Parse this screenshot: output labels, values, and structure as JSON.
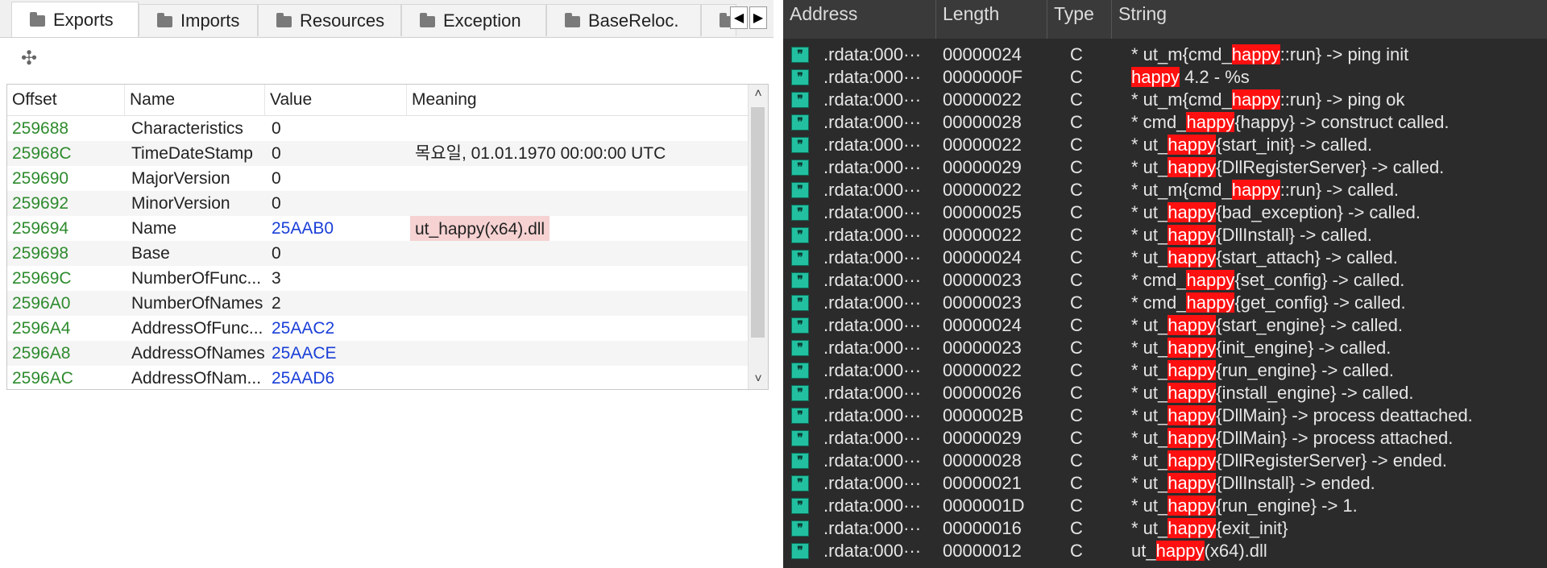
{
  "left": {
    "tabs": [
      {
        "label": "Exports",
        "icon": "folder-icon",
        "active": true
      },
      {
        "label": "Imports",
        "icon": "folder-icon",
        "active": false
      },
      {
        "label": "Resources",
        "icon": "folder-icon",
        "active": false
      },
      {
        "label": "Exception",
        "icon": "folder-icon",
        "active": false
      },
      {
        "label": "BaseReloc.",
        "icon": "folder-icon",
        "active": false
      }
    ],
    "tab_nav": {
      "prev": "◀",
      "next": "▶"
    },
    "move_icon": "✣",
    "columns": [
      "Offset",
      "Name",
      "Value",
      "Meaning"
    ],
    "rows": [
      {
        "offset": "259688",
        "name": "Characteristics",
        "value": "0",
        "meaning": "",
        "value_link": false,
        "meaning_highlight": false
      },
      {
        "offset": "25968C",
        "name": "TimeDateStamp",
        "value": "0",
        "meaning": "목요일, 01.01.1970 00:00:00 UTC",
        "value_link": false,
        "meaning_highlight": false
      },
      {
        "offset": "259690",
        "name": "MajorVersion",
        "value": "0",
        "meaning": "",
        "value_link": false,
        "meaning_highlight": false
      },
      {
        "offset": "259692",
        "name": "MinorVersion",
        "value": "0",
        "meaning": "",
        "value_link": false,
        "meaning_highlight": false
      },
      {
        "offset": "259694",
        "name": "Name",
        "value": "25AAB0",
        "meaning": "ut_happy(x64).dll",
        "value_link": true,
        "meaning_highlight": true
      },
      {
        "offset": "259698",
        "name": "Base",
        "value": "0",
        "meaning": "",
        "value_link": false,
        "meaning_highlight": false
      },
      {
        "offset": "25969C",
        "name": "NumberOfFunc...",
        "value": "3",
        "meaning": "",
        "value_link": false,
        "meaning_highlight": false
      },
      {
        "offset": "2596A0",
        "name": "NumberOfNames",
        "value": "2",
        "meaning": "",
        "value_link": false,
        "meaning_highlight": false
      },
      {
        "offset": "2596A4",
        "name": "AddressOfFunc...",
        "value": "25AAC2",
        "meaning": "",
        "value_link": true,
        "meaning_highlight": false
      },
      {
        "offset": "2596A8",
        "name": "AddressOfNames",
        "value": "25AACE",
        "meaning": "",
        "value_link": true,
        "meaning_highlight": false
      },
      {
        "offset": "2596AC",
        "name": "AddressOfNam...",
        "value": "25AAD6",
        "meaning": "",
        "value_link": true,
        "meaning_highlight": false
      }
    ],
    "scroll_up": "˄",
    "scroll_down": "˅"
  },
  "right": {
    "columns": [
      "Address",
      "Length",
      "Type",
      "String"
    ],
    "string_icon": "string-icon",
    "rows": [
      {
        "address": ".rdata:000···",
        "length": "00000024",
        "type": "C",
        "parts": [
          [
            "* ut_m{cmd_",
            false
          ],
          [
            "happy",
            true
          ],
          [
            "::run} -> ping init",
            false
          ]
        ]
      },
      {
        "address": ".rdata:000···",
        "length": "0000000F",
        "type": "C",
        "parts": [
          [
            "happy",
            true
          ],
          [
            " 4.2 - %s",
            false
          ]
        ]
      },
      {
        "address": ".rdata:000···",
        "length": "00000022",
        "type": "C",
        "parts": [
          [
            "* ut_m{cmd_",
            false
          ],
          [
            "happy",
            true
          ],
          [
            "::run} -> ping ok",
            false
          ]
        ]
      },
      {
        "address": ".rdata:000···",
        "length": "00000028",
        "type": "C",
        "parts": [
          [
            "* cmd_",
            false
          ],
          [
            "happy",
            true
          ],
          [
            "{happy} -> construct called.",
            false
          ]
        ]
      },
      {
        "address": ".rdata:000···",
        "length": "00000022",
        "type": "C",
        "parts": [
          [
            "* ut_",
            false
          ],
          [
            "happy",
            true
          ],
          [
            "{start_init} -> called.",
            false
          ]
        ]
      },
      {
        "address": ".rdata:000···",
        "length": "00000029",
        "type": "C",
        "parts": [
          [
            "* ut_",
            false
          ],
          [
            "happy",
            true
          ],
          [
            "{DllRegisterServer} -> called.",
            false
          ]
        ]
      },
      {
        "address": ".rdata:000···",
        "length": "00000022",
        "type": "C",
        "parts": [
          [
            "* ut_m{cmd_",
            false
          ],
          [
            "happy",
            true
          ],
          [
            "::run} -> called.",
            false
          ]
        ]
      },
      {
        "address": ".rdata:000···",
        "length": "00000025",
        "type": "C",
        "parts": [
          [
            "* ut_",
            false
          ],
          [
            "happy",
            true
          ],
          [
            "{bad_exception} -> called.",
            false
          ]
        ]
      },
      {
        "address": ".rdata:000···",
        "length": "00000022",
        "type": "C",
        "parts": [
          [
            "* ut_",
            false
          ],
          [
            "happy",
            true
          ],
          [
            "{DllInstall} -> called.",
            false
          ]
        ]
      },
      {
        "address": ".rdata:000···",
        "length": "00000024",
        "type": "C",
        "parts": [
          [
            "* ut_",
            false
          ],
          [
            "happy",
            true
          ],
          [
            "{start_attach} -> called.",
            false
          ]
        ]
      },
      {
        "address": ".rdata:000···",
        "length": "00000023",
        "type": "C",
        "parts": [
          [
            "* cmd_",
            false
          ],
          [
            "happy",
            true
          ],
          [
            "{set_config} -> called.",
            false
          ]
        ]
      },
      {
        "address": ".rdata:000···",
        "length": "00000023",
        "type": "C",
        "parts": [
          [
            "* cmd_",
            false
          ],
          [
            "happy",
            true
          ],
          [
            "{get_config} -> called.",
            false
          ]
        ]
      },
      {
        "address": ".rdata:000···",
        "length": "00000024",
        "type": "C",
        "parts": [
          [
            "* ut_",
            false
          ],
          [
            "happy",
            true
          ],
          [
            "{start_engine} -> called.",
            false
          ]
        ]
      },
      {
        "address": ".rdata:000···",
        "length": "00000023",
        "type": "C",
        "parts": [
          [
            "* ut_",
            false
          ],
          [
            "happy",
            true
          ],
          [
            "{init_engine} -> called.",
            false
          ]
        ]
      },
      {
        "address": ".rdata:000···",
        "length": "00000022",
        "type": "C",
        "parts": [
          [
            "* ut_",
            false
          ],
          [
            "happy",
            true
          ],
          [
            "{run_engine} -> called.",
            false
          ]
        ]
      },
      {
        "address": ".rdata:000···",
        "length": "00000026",
        "type": "C",
        "parts": [
          [
            "* ut_",
            false
          ],
          [
            "happy",
            true
          ],
          [
            "{install_engine} -> called.",
            false
          ]
        ]
      },
      {
        "address": ".rdata:000···",
        "length": "0000002B",
        "type": "C",
        "parts": [
          [
            "* ut_",
            false
          ],
          [
            "happy",
            true
          ],
          [
            "{DllMain} -> process deattached.",
            false
          ]
        ]
      },
      {
        "address": ".rdata:000···",
        "length": "00000029",
        "type": "C",
        "parts": [
          [
            "* ut_",
            false
          ],
          [
            "happy",
            true
          ],
          [
            "{DllMain} -> process attached.",
            false
          ]
        ]
      },
      {
        "address": ".rdata:000···",
        "length": "00000028",
        "type": "C",
        "parts": [
          [
            "* ut_",
            false
          ],
          [
            "happy",
            true
          ],
          [
            "{DllRegisterServer} -> ended.",
            false
          ]
        ]
      },
      {
        "address": ".rdata:000···",
        "length": "00000021",
        "type": "C",
        "parts": [
          [
            "* ut_",
            false
          ],
          [
            "happy",
            true
          ],
          [
            "{DllInstall} -> ended.",
            false
          ]
        ]
      },
      {
        "address": ".rdata:000···",
        "length": "0000001D",
        "type": "C",
        "parts": [
          [
            "* ut_",
            false
          ],
          [
            "happy",
            true
          ],
          [
            "{run_engine} -> 1.",
            false
          ]
        ]
      },
      {
        "address": ".rdata:000···",
        "length": "00000016",
        "type": "C",
        "parts": [
          [
            "* ut_",
            false
          ],
          [
            "happy",
            true
          ],
          [
            "{exit_init}",
            false
          ]
        ]
      },
      {
        "address": ".rdata:000···",
        "length": "00000012",
        "type": "C",
        "parts": [
          [
            "ut_",
            false
          ],
          [
            "happy",
            true
          ],
          [
            "(x64).dll",
            false
          ]
        ]
      }
    ]
  },
  "colors": {
    "offset_green": "#2e8b2e",
    "link_blue": "#1a3fd8",
    "highlight_red": "#ff1010",
    "meaning_pink": "#f6d2d2",
    "dark_bg": "#2b2b2b"
  }
}
